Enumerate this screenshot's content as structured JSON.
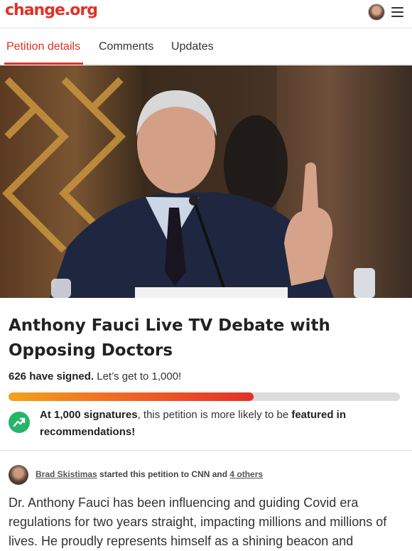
{
  "header": {
    "logo_text": "change.org",
    "brand_color": "#e0312a"
  },
  "tabs": [
    {
      "label": "Petition details",
      "active": true
    },
    {
      "label": "Comments",
      "active": false
    },
    {
      "label": "Updates",
      "active": false
    }
  ],
  "petition": {
    "title": "Anthony Fauci Live TV Debate with Opposing Doctors",
    "signed_count_text": "626 have signed.",
    "goal_text": " Let’s get to 1,000!",
    "progress_fraction": 0.626,
    "milestone": {
      "pre": "At 1,000 signatures",
      "mid": ", this petition is more likely to be ",
      "bold": "featured in recommendations!"
    },
    "starter": {
      "name": "Brad Skistimas",
      "started_text": " started this petition to CNN and ",
      "others": "4 others"
    },
    "description": "Dr. Anthony Fauci has been influencing and guiding Covid era regulations for two years straight, impacting millions and millions of lives. He proudly represents himself as a shining beacon and"
  },
  "icons": [
    "menu-icon",
    "trending-up-icon",
    "user-avatar"
  ]
}
